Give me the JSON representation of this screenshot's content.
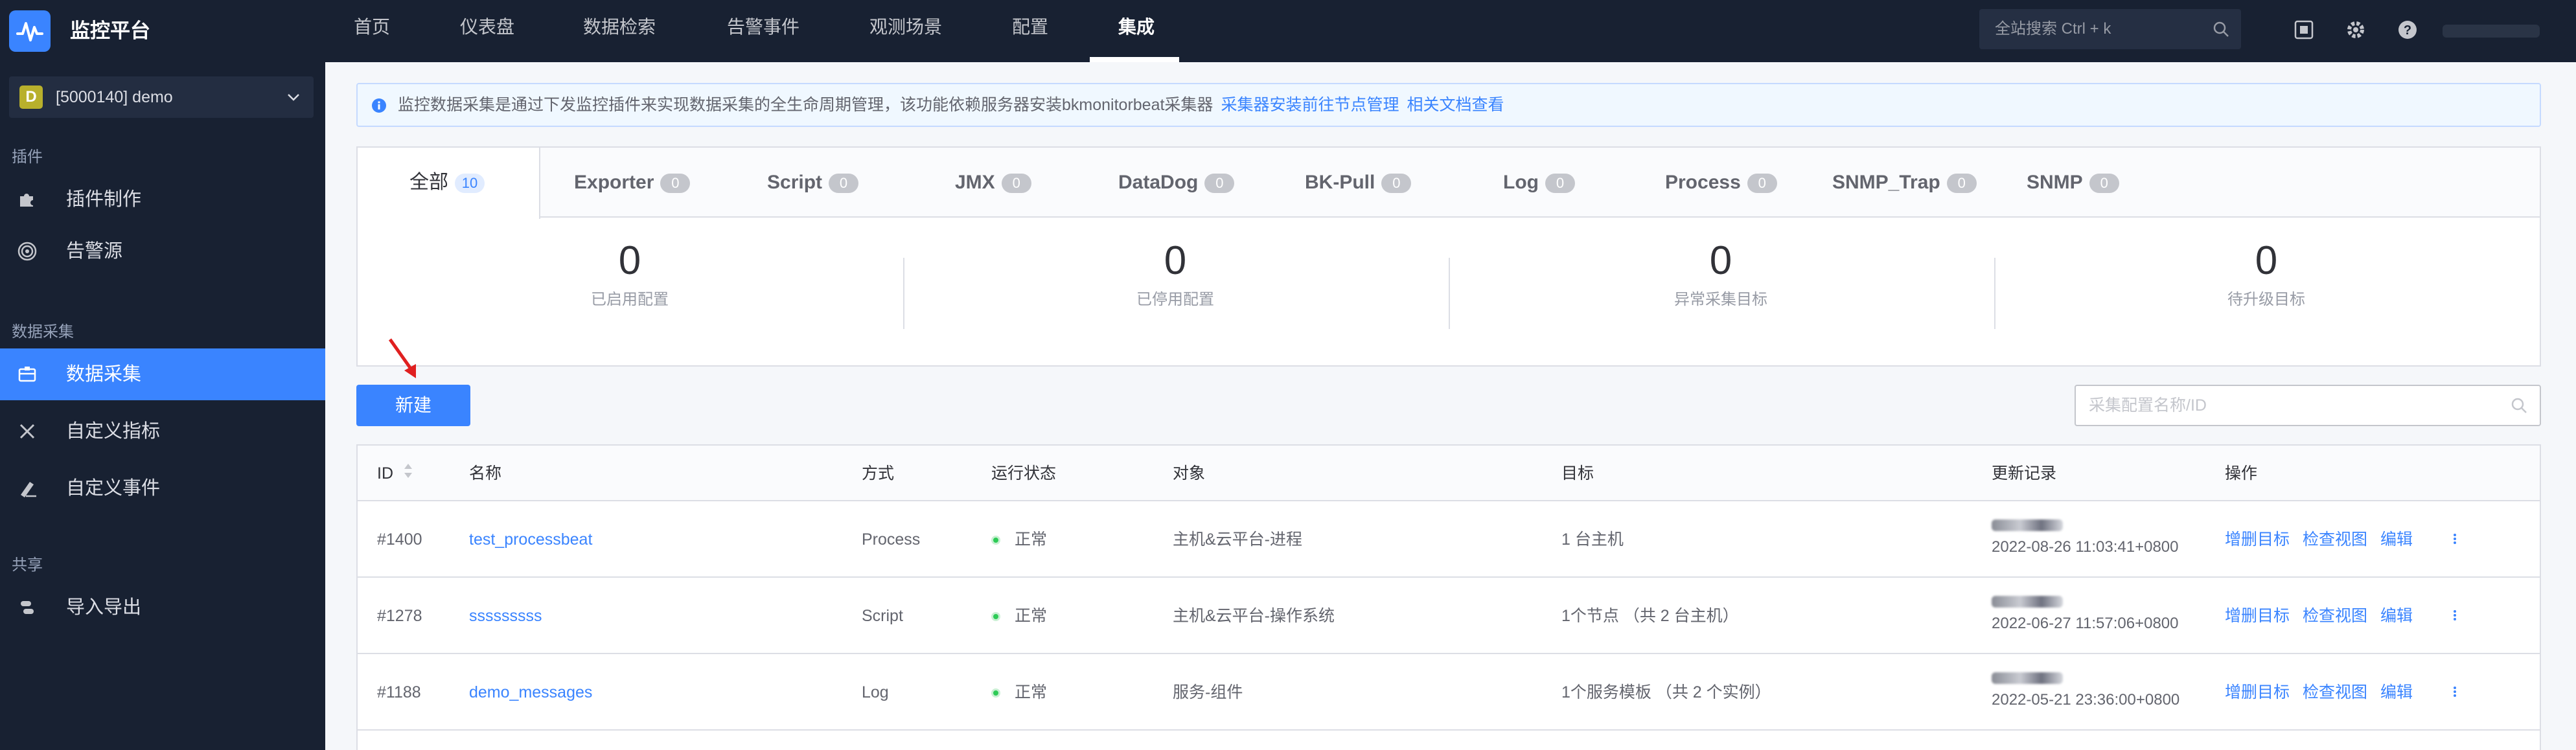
{
  "app": {
    "title": "监控平台",
    "nav": [
      "首页",
      "仪表盘",
      "数据检索",
      "告警事件",
      "观测场景",
      "配置",
      "集成"
    ],
    "active_nav": "集成",
    "search_placeholder": "全站搜索 Ctrl + k",
    "accent": "#3a84ff",
    "header_bg": "#182132"
  },
  "sidebar": {
    "business": {
      "badge": "D",
      "label": "[5000140] demo"
    },
    "groups": [
      {
        "title": "插件",
        "items": [
          {
            "label": "插件制作",
            "icon": "puzzle-icon"
          },
          {
            "label": "告警源",
            "icon": "target-icon"
          }
        ]
      },
      {
        "title": "数据采集",
        "items": [
          {
            "label": "数据采集",
            "icon": "collect-icon",
            "active": true
          },
          {
            "label": "自定义指标",
            "icon": "custom-metric-icon"
          },
          {
            "label": "自定义事件",
            "icon": "custom-event-icon"
          }
        ]
      },
      {
        "title": "共享",
        "items": [
          {
            "label": "导入导出",
            "icon": "import-export-icon"
          }
        ]
      }
    ]
  },
  "notice": {
    "text": "监控数据采集是通过下发监控插件来实现数据采集的全生命周期管理，该功能依赖服务器安装bkmonitorbeat采集器",
    "link1": "采集器安装前往节点管理",
    "link2": "相关文档查看"
  },
  "tabs": [
    {
      "label": "全部",
      "count": "10"
    },
    {
      "label": "Exporter",
      "count": "0"
    },
    {
      "label": "Script",
      "count": "0"
    },
    {
      "label": "JMX",
      "count": "0"
    },
    {
      "label": "DataDog",
      "count": "0"
    },
    {
      "label": "BK-Pull",
      "count": "0"
    },
    {
      "label": "Log",
      "count": "0"
    },
    {
      "label": "Process",
      "count": "0"
    },
    {
      "label": "SNMP_Trap",
      "count": "0"
    },
    {
      "label": "SNMP",
      "count": "0"
    }
  ],
  "stats": [
    {
      "value": "0",
      "label": "已启用配置"
    },
    {
      "value": "0",
      "label": "已停用配置"
    },
    {
      "value": "0",
      "label": "异常采集目标"
    },
    {
      "value": "0",
      "label": "待升级目标"
    }
  ],
  "toolbar": {
    "new_label": "新建",
    "search_placeholder": "采集配置名称/ID"
  },
  "table": {
    "headers": [
      "ID",
      "名称",
      "方式",
      "运行状态",
      "对象",
      "目标",
      "更新记录",
      "操作"
    ],
    "rows": [
      {
        "id": "#1400",
        "name": "test_processbeat",
        "method": "Process",
        "status": "正常",
        "object": "主机&云平台-进程",
        "target": "1 台主机",
        "updated": "2022-08-26 11:03:41+0800"
      },
      {
        "id": "#1278",
        "name": "sssssssss",
        "method": "Script",
        "status": "正常",
        "object": "主机&云平台-操作系统",
        "target": "1个节点 （共 2 台主机）",
        "updated": "2022-06-27 11:57:06+0800"
      },
      {
        "id": "#1188",
        "name": "demo_messages",
        "method": "Log",
        "status": "正常",
        "object": "服务-组件",
        "target": "1个服务模板 （共 2 个实例）",
        "updated": "2022-05-21 23:36:00+0800"
      }
    ],
    "actions": [
      "增删目标",
      "检查视图",
      "编辑"
    ]
  }
}
